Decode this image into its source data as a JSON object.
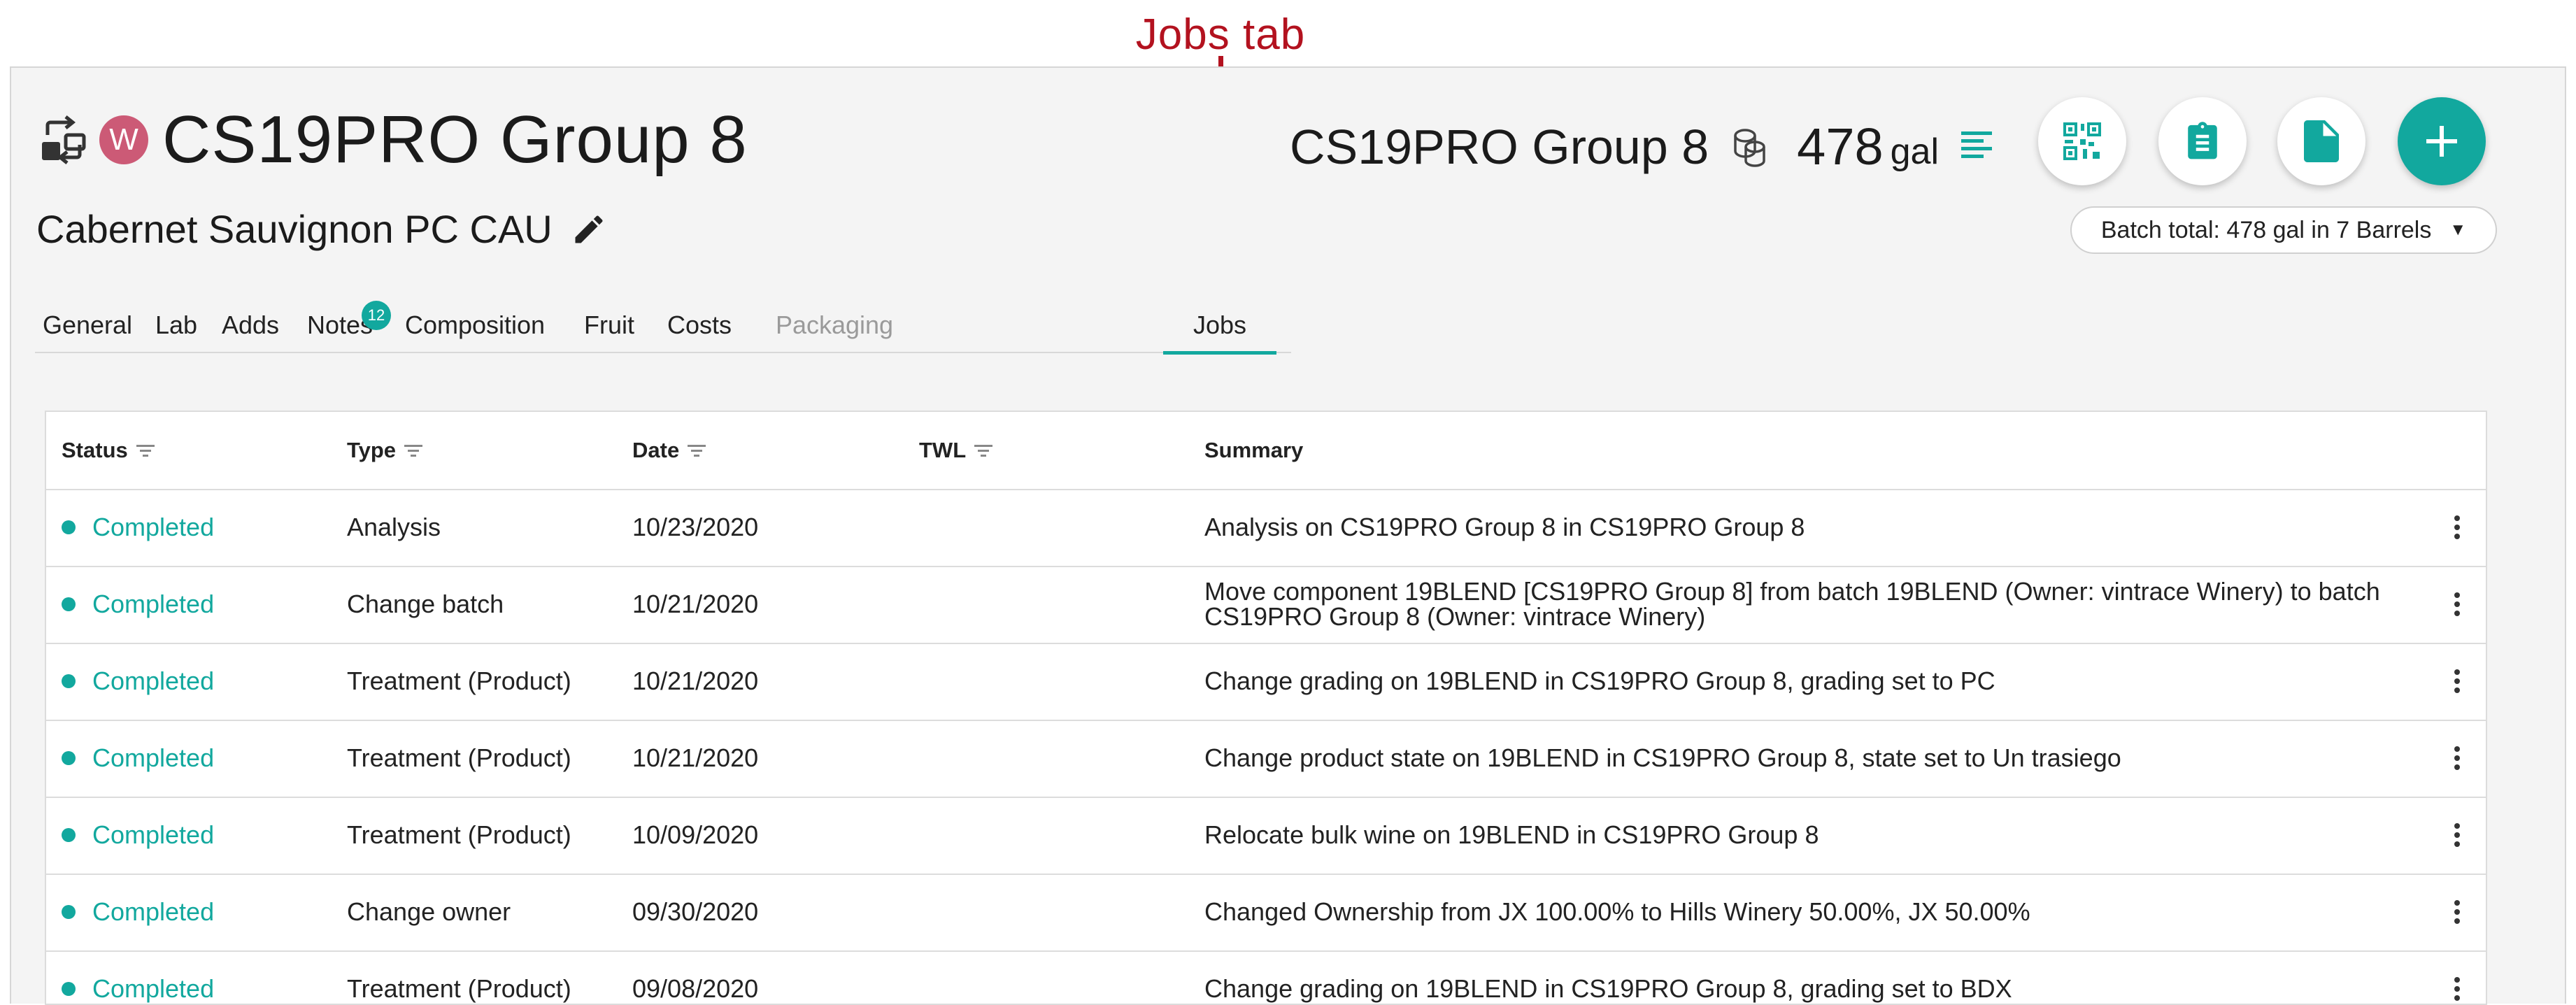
{
  "annotation": {
    "label": "Jobs tab"
  },
  "header": {
    "title": "CS19PRO Group 8",
    "avatar_letter": "W",
    "subtitle": "Cabernet Sauvignon PC CAU",
    "vessel_name": "CS19PRO Group 8",
    "volume": "478",
    "volume_unit": "gal",
    "batch_total": "Batch total: 478 gal in 7 Barrels",
    "icons": [
      "swap-icon",
      "edit-icon",
      "barrels-icon",
      "list-lines-icon",
      "qr-code-icon",
      "clipboard-icon",
      "document-icon",
      "plus-icon"
    ]
  },
  "colors": {
    "accent": "#12a89e",
    "avatar": "#cc5a76",
    "annotation": "#b3121f"
  },
  "tabs": [
    {
      "label": "General"
    },
    {
      "label": "Lab"
    },
    {
      "label": "Adds"
    },
    {
      "label": "Notes",
      "badge": "12"
    },
    {
      "label": "Composition"
    },
    {
      "label": "Fruit"
    },
    {
      "label": "Costs"
    },
    {
      "label": "Packaging",
      "state": "disabled"
    },
    {
      "label": "Jobs",
      "state": "active"
    }
  ],
  "table": {
    "columns": [
      {
        "label": "Status",
        "filter": true
      },
      {
        "label": "Type",
        "filter": true
      },
      {
        "label": "Date",
        "filter": true
      },
      {
        "label": "TWL",
        "filter": true
      },
      {
        "label": "Summary",
        "filter": false
      }
    ],
    "rows": [
      {
        "status": "Completed",
        "type": "Analysis",
        "date": "10/23/2020",
        "twl": "",
        "summary": "Analysis on CS19PRO Group 8 in CS19PRO Group 8"
      },
      {
        "status": "Completed",
        "type": "Change batch",
        "date": "10/21/2020",
        "twl": "",
        "summary": "Move component 19BLEND [CS19PRO Group 8] from batch 19BLEND (Owner: vintrace Winery) to batch CS19PRO Group 8 (Owner: vintrace Winery)"
      },
      {
        "status": "Completed",
        "type": "Treatment (Product)",
        "date": "10/21/2020",
        "twl": "",
        "summary": "Change grading on 19BLEND in CS19PRO Group 8, grading set to PC"
      },
      {
        "status": "Completed",
        "type": "Treatment (Product)",
        "date": "10/21/2020",
        "twl": "",
        "summary": "Change product state on 19BLEND in CS19PRO Group 8, state set to Un trasiego"
      },
      {
        "status": "Completed",
        "type": "Treatment (Product)",
        "date": "10/09/2020",
        "twl": "",
        "summary": "Relocate bulk wine on 19BLEND in CS19PRO Group 8"
      },
      {
        "status": "Completed",
        "type": "Change owner",
        "date": "09/30/2020",
        "twl": "",
        "summary": "Changed Ownership from JX 100.00% to Hills Winery 50.00%, JX 50.00%"
      },
      {
        "status": "Completed",
        "type": "Treatment (Product)",
        "date": "09/08/2020",
        "twl": "",
        "summary": "Change grading on 19BLEND in CS19PRO Group 8, grading set to BDX"
      }
    ]
  }
}
